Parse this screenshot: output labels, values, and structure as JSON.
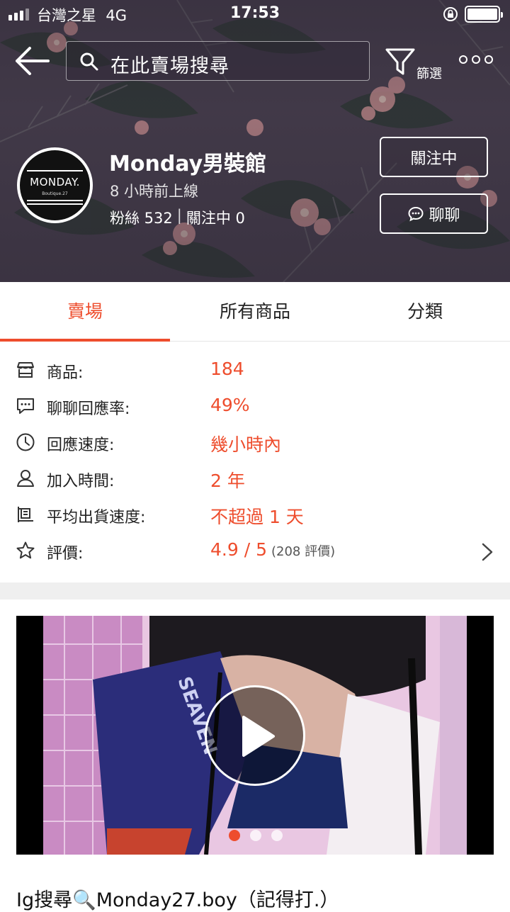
{
  "status_bar": {
    "carrier": "台灣之星",
    "network": "4G",
    "time": "17:53"
  },
  "header": {
    "search_placeholder": "在此賣場搜尋",
    "filter_label": "篩選"
  },
  "shop": {
    "avatar_title": "MONDAY.",
    "avatar_sub": "Boutique.27",
    "name": "Monday男裝館",
    "last_online": "8 小時前上線",
    "followers": "粉絲 532",
    "separator": "|",
    "following": "關注中 0",
    "follow_button": "關注中",
    "chat_button": "聊聊"
  },
  "tabs": [
    {
      "label": "賣場",
      "active": true
    },
    {
      "label": "所有商品",
      "active": false
    },
    {
      "label": "分類",
      "active": false
    }
  ],
  "info": [
    {
      "icon": "shop-icon",
      "label": "商品:",
      "value": "184"
    },
    {
      "icon": "chat-bubble-icon",
      "label": "聊聊回應率:",
      "value": "49%"
    },
    {
      "icon": "clock-icon",
      "label": "回應速度:",
      "value": "幾小時內"
    },
    {
      "icon": "user-icon",
      "label": "加入時間:",
      "value": "2 年"
    },
    {
      "icon": "shipping-icon",
      "label": "平均出貨速度:",
      "value": "不超過 1 天"
    },
    {
      "icon": "star-icon",
      "label": "評價:",
      "value": "4.9 / 5",
      "extra": "(208 評價)"
    }
  ],
  "carousel": {
    "slides": 3,
    "active": 1
  },
  "caption": "Ig搜尋🔍Monday27.boy（記得打.）",
  "colors": {
    "accent": "#ee4d2d"
  }
}
